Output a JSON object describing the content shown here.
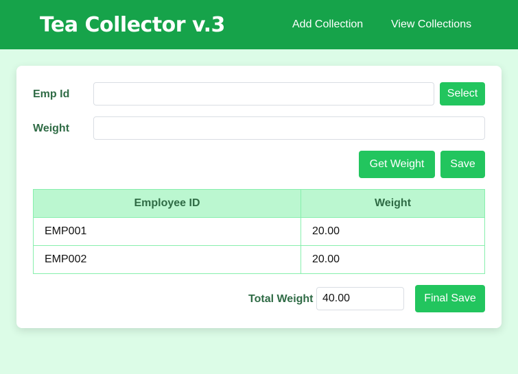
{
  "app": {
    "title": "Tea Collector v.3"
  },
  "nav": {
    "add_collection": "Add Collection",
    "view_collections": "View Collections"
  },
  "form": {
    "emp_id_label": "Emp Id",
    "emp_id_value": "",
    "weight_label": "Weight",
    "weight_value": "",
    "select_label": "Select",
    "get_weight_label": "Get Weight",
    "save_label": "Save"
  },
  "table": {
    "headers": [
      "Employee ID",
      "Weight"
    ],
    "rows": [
      [
        "EMP001",
        "20.00"
      ],
      [
        "EMP002",
        "20.00"
      ]
    ]
  },
  "footer": {
    "total_label": "Total Weight",
    "total_value": "40.00",
    "final_save_label": "Final Save"
  },
  "colors": {
    "navbar": "#16a34a",
    "accent": "#22c55e",
    "background": "#dcfce7",
    "table_header": "#bbf7d0"
  }
}
